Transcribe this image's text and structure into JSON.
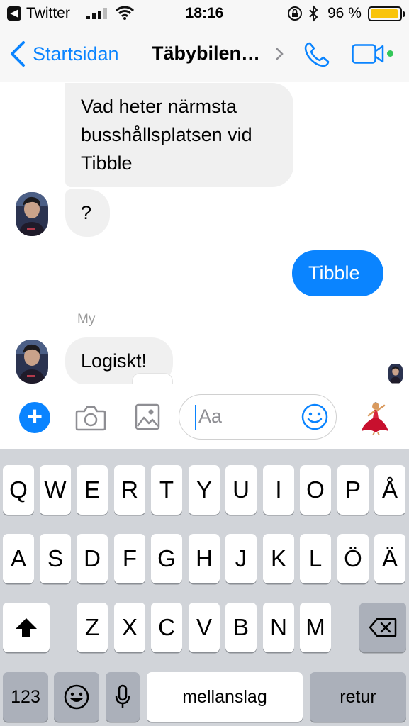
{
  "status_bar": {
    "back_app": "Twitter",
    "time": "18:16",
    "battery_percent": "96 %",
    "battery_level": 0.96,
    "icons": [
      "signal-icon",
      "wifi-icon",
      "orientation-lock-icon",
      "bluetooth-icon",
      "battery-icon"
    ]
  },
  "nav": {
    "back_label": "Startsidan",
    "title": "Täbybilen…",
    "icons": [
      "chevron-left-icon",
      "chevron-right-icon",
      "phone-icon",
      "video-icon"
    ]
  },
  "messages": [
    {
      "side": "incoming",
      "text": "Vad heter närmsta\nbusshållsplatsen vid\nTibble"
    },
    {
      "side": "incoming",
      "text": "?"
    },
    {
      "side": "outgoing",
      "text": "Tibble"
    },
    {
      "side": "incoming",
      "sender": "My",
      "text": "Logiskt!"
    }
  ],
  "composer": {
    "placeholder": "Aa",
    "icons": [
      "plus-icon",
      "camera-icon",
      "gallery-icon",
      "emoji-smile-icon",
      "dancer-emoji-icon"
    ]
  },
  "keyboard": {
    "row1": [
      "Q",
      "W",
      "E",
      "R",
      "T",
      "Y",
      "U",
      "I",
      "O",
      "P",
      "Å"
    ],
    "row2": [
      "A",
      "S",
      "D",
      "F",
      "G",
      "H",
      "J",
      "K",
      "L",
      "Ö",
      "Ä"
    ],
    "row3": [
      "Z",
      "X",
      "C",
      "V",
      "B",
      "N",
      "M"
    ],
    "numbers_label": "123",
    "space_label": "mellanslag",
    "return_label": "retur"
  },
  "colors": {
    "accent": "#0a84ff",
    "incoming_bubble": "#f0f0f0",
    "online_dot": "#34c759",
    "keyboard_bg": "#d1d4d9"
  }
}
